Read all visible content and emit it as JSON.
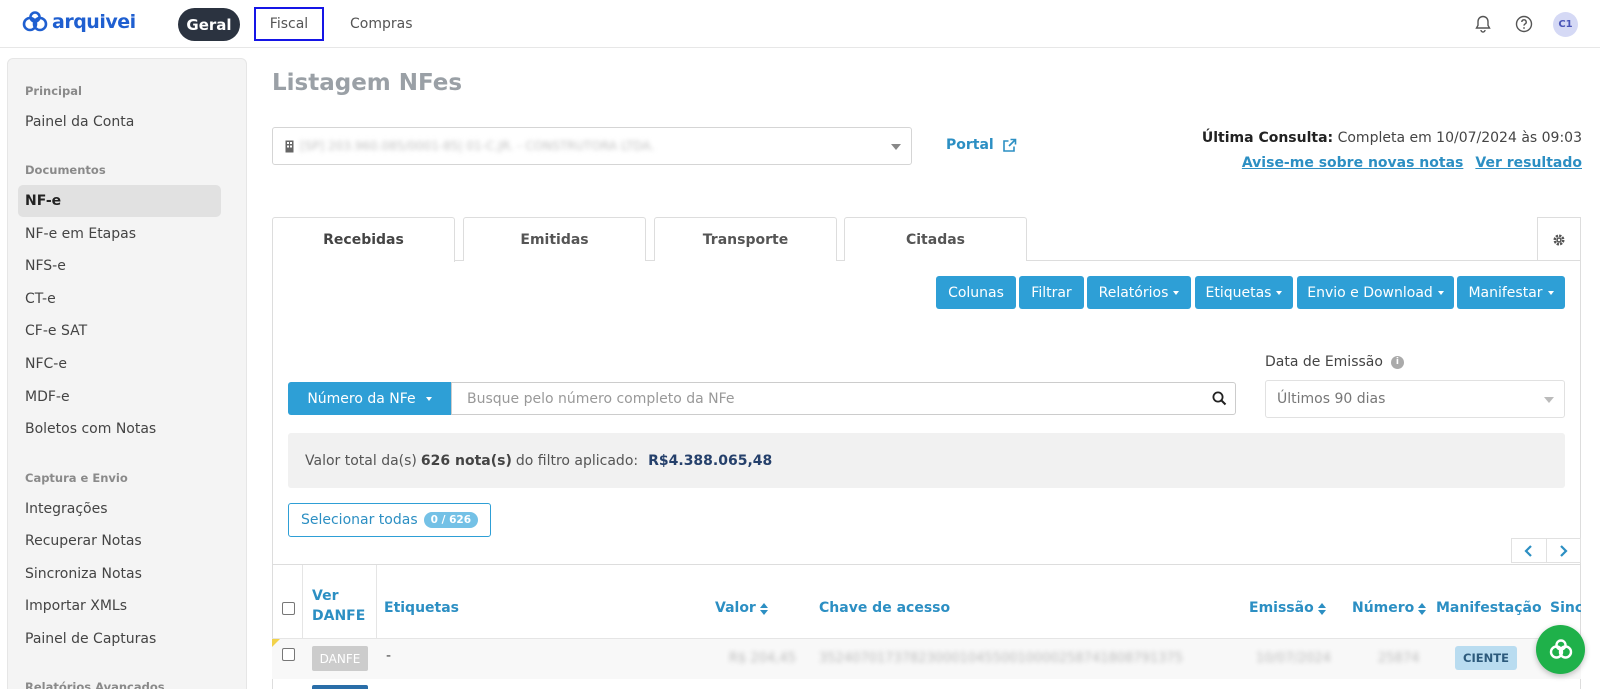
{
  "brand": {
    "name": "arquivei",
    "color": "#1f5fd0"
  },
  "topnav": {
    "geral": "Geral",
    "fiscal": "Fiscal",
    "compras": "Compras",
    "icons": [
      "bell-icon",
      "help-icon"
    ],
    "avatar": "C1"
  },
  "sidebar": {
    "sections": [
      {
        "title": "Principal",
        "items": [
          "Painel da Conta"
        ]
      },
      {
        "title": "Documentos",
        "items": [
          "NF-e",
          "NF-e em Etapas",
          "NFS-e",
          "CT-e",
          "CF-e SAT",
          "NFC-e",
          "MDF-e",
          "Boletos com Notas"
        ]
      },
      {
        "title": "Captura e Envio",
        "items": [
          "Integrações",
          "Recuperar Notas",
          "Sincroniza Notas",
          "Importar XMLs",
          "Painel de Capturas"
        ]
      },
      {
        "title": "Relatórios Avançados",
        "items": []
      }
    ],
    "active": "NF-e"
  },
  "header": {
    "title": "Listagem NFes",
    "company": "[SP] 203.960.085/0001-85| 01-C.JR. - CONSTRUTORA LTDA.",
    "portal": "Portal",
    "ultima_label": "Última Consulta:",
    "ultima_value": "Completa em 10/07/2024 às 09:03",
    "link_avise": "Avise-me sobre novas notas",
    "link_ver": "Ver resultado"
  },
  "tabs": [
    "Recebidas",
    "Emitidas",
    "Transporte",
    "Citadas"
  ],
  "active_tab": "Recebidas",
  "toolbar": {
    "colunas": "Colunas",
    "filtrar": "Filtrar",
    "relatorios": "Relatórios",
    "etiquetas": "Etiquetas",
    "envio": "Envio e Download",
    "manifestar": "Manifestar"
  },
  "search": {
    "type": "Número da NFe",
    "placeholder": "Busque pelo número completo da NFe"
  },
  "date_filter": {
    "label": "Data de Emissão",
    "value": "Últimos 90 dias"
  },
  "summary": {
    "prefix": "Valor total da(s)",
    "count": "626 nota(s)",
    "suffix": "do filtro aplicado:",
    "total": "R$4.388.065,48"
  },
  "select_all": {
    "label": "Selecionar todas",
    "badge": "0 / 626"
  },
  "table": {
    "columns": [
      "Ver DANFE",
      "Etiquetas",
      "Valor",
      "Chave de acesso",
      "Emissão",
      "Número",
      "Manifestação",
      "Sinc"
    ],
    "rows": [
      {
        "danfe": "DANFE",
        "etiquetas": "-",
        "valor": "R$ 204,45",
        "chave": "35240701737823000104550010000258741808791375",
        "emissao": "10/07/2024",
        "numero": "25874",
        "manifestacao": "CIENTE"
      }
    ]
  },
  "colors": {
    "accent": "#2e9fd6",
    "link": "#2c8fc3",
    "fab": "#1fb14a"
  }
}
